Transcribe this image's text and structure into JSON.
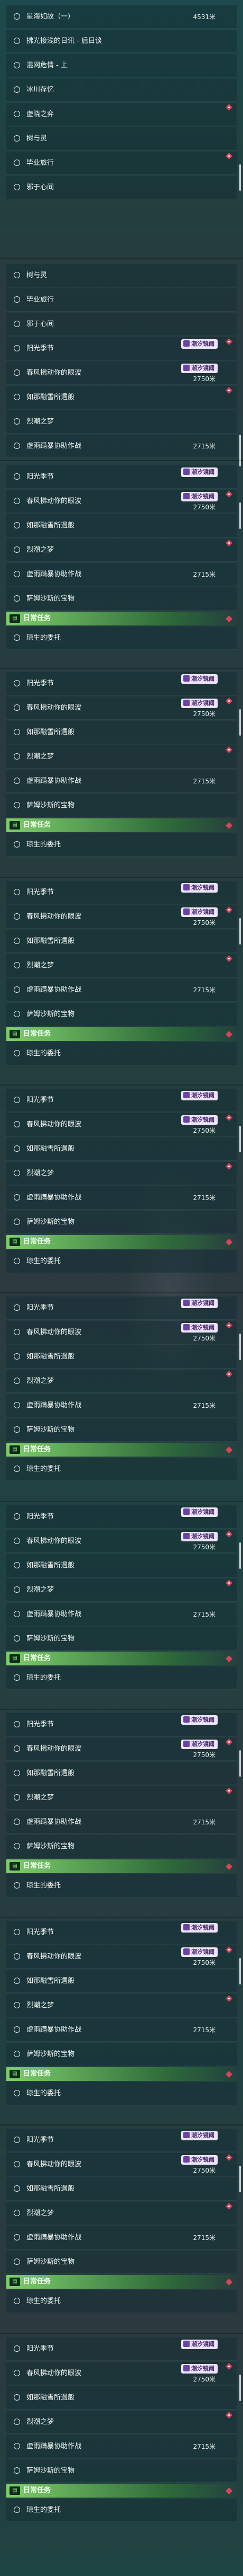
{
  "panel1": {
    "items": [
      {
        "name": "星海如故（一）",
        "distance": "4531米"
      },
      {
        "name": "拂光接浅的日讯 - 后日谈"
      },
      {
        "name": "混网危情 - 上"
      },
      {
        "name": "冰川存忆"
      },
      {
        "name": "虚晓之弈"
      },
      {
        "name": "树与灵"
      },
      {
        "name": "毕业旅行"
      },
      {
        "name": "邪于心间"
      }
    ]
  },
  "panel2": {
    "items": [
      {
        "name": "树与灵"
      },
      {
        "name": "毕业旅行"
      },
      {
        "name": "邪于心间"
      },
      {
        "name": "阳光季节",
        "badge": "潮汐镜阈"
      },
      {
        "name": "春风拂动你的眼波",
        "distance": "2750米",
        "badge": "潮汐镜阈"
      },
      {
        "name": "如那融雪所遇般"
      },
      {
        "name": "烈潮之梦"
      },
      {
        "name": "虚雨蹒暴协助作战",
        "distance": "2715米"
      }
    ]
  },
  "block": {
    "items": [
      {
        "name": "阳光季节",
        "badge": "潮汐镜阈"
      },
      {
        "name": "春风拂动你的眼波",
        "distance": "2750米",
        "badge": "潮汐镜阈"
      },
      {
        "name": "如那融雪所遇般"
      },
      {
        "name": "烈潮之梦"
      },
      {
        "name": "虚雨蹒暴协助作战",
        "distance": "2715米"
      },
      {
        "name": "萨姆沙斯的宝物"
      }
    ],
    "section_title": "日常任务",
    "section_icon": "task-icon",
    "daily_item": "琼生的委托"
  },
  "colors": {
    "accent_green": "#7ecf6a",
    "badge_purple": "#6b44a3",
    "marker_red": "#d9445a"
  }
}
